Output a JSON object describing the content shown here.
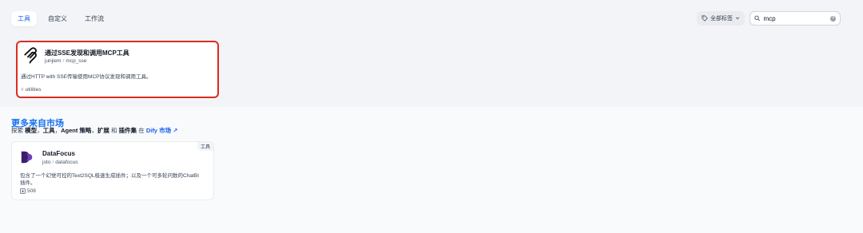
{
  "tabs": [
    {
      "label": "工具",
      "active": true
    },
    {
      "label": "自定义",
      "active": false
    },
    {
      "label": "工作流",
      "active": false
    }
  ],
  "tag_filter": {
    "label": "全部标签",
    "icon": "tag-icon"
  },
  "search": {
    "value": "mcp",
    "icon": "search-icon"
  },
  "tool_card": {
    "title": "通过SSE发现和调用MCP工具",
    "author": "junjiem",
    "slash": "/",
    "name": "mcp_sse",
    "description": "通过HTTP with SSE传输使用MCP协议发现和调用工具。",
    "tag": "utilities",
    "hash": "#"
  },
  "marketplace": {
    "title": "更多来自市场",
    "intro": "探索",
    "k1": "模型",
    "sep1": "，",
    "k2": "工具",
    "sep2": "，",
    "k3": "Agent 策略",
    "sep3": "，",
    "k4": "扩展",
    "and": "和",
    "k5": "插件集",
    "in": "在",
    "link": "Dify 市场",
    "link_arrow": "↗"
  },
  "market_card": {
    "badge": "工具",
    "title": "DataFocus",
    "author": "joto",
    "slash": "/",
    "name": "datafocus",
    "description": "包含了一个幻觉可控的Text2SQL极速生成插件；以及一个可多轮问数的ChatBI插件。",
    "downloads": "508"
  },
  "colors": {
    "accent": "#155eef",
    "highlight_border": "#d92d20",
    "market_title": "#1570ef"
  }
}
